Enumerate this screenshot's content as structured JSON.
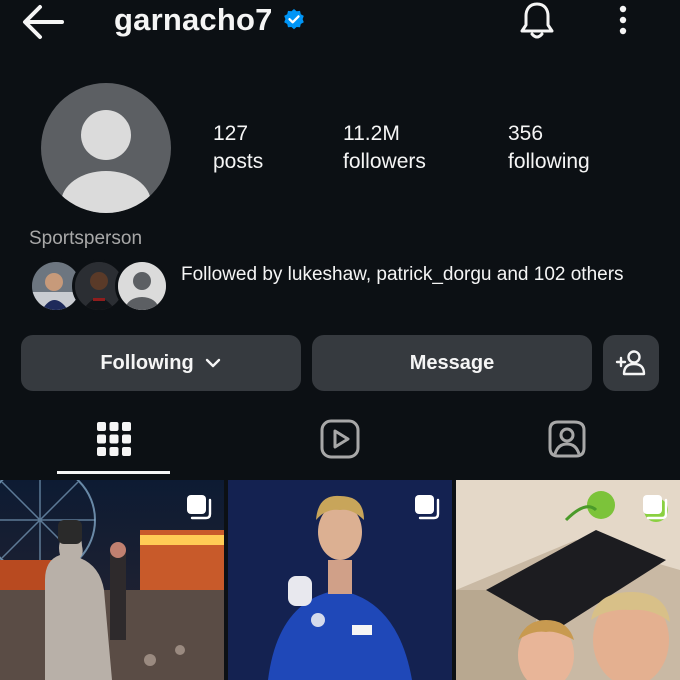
{
  "header": {
    "username": "garnacho7",
    "icons": [
      "back-arrow-icon",
      "verified-badge-icon",
      "bell-icon",
      "more-vertical-icon"
    ]
  },
  "profile": {
    "stats": [
      {
        "value": "127",
        "label": "posts"
      },
      {
        "value": "11.2M",
        "label": "followers"
      },
      {
        "value": "356",
        "label": "following"
      }
    ],
    "category": "Sportsperson",
    "followed_by": "Followed by lukeshaw, patrick_dorgu and 102 others"
  },
  "actions": {
    "following_label": "Following",
    "message_label": "Message"
  },
  "tabs": {
    "items": [
      "grid-icon",
      "reels-icon",
      "tagged-icon"
    ],
    "selected": 0
  },
  "colors": {
    "background": "#0c1014",
    "button": "#363a3f",
    "verified": "#0095f6",
    "secondary_text": "#a8a8a8"
  }
}
